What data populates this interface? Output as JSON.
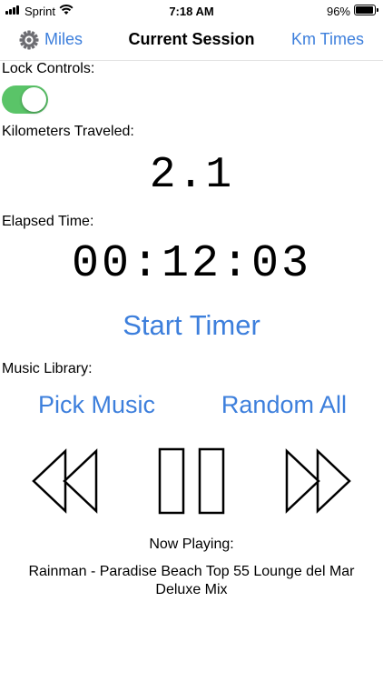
{
  "status_bar": {
    "carrier": "Sprint",
    "time": "7:18 AM",
    "battery_percent": "96%",
    "battery_level": 0.96,
    "icons": [
      "signal-icon",
      "wifi-icon",
      "battery-icon"
    ]
  },
  "nav": {
    "left_label": "Miles",
    "title": "Current Session",
    "right_label": "Km Times",
    "left_icon": "gear-icon"
  },
  "lock": {
    "label": "Lock Controls:",
    "on": true
  },
  "distance": {
    "label": "Kilometers Traveled:",
    "value": "2.1"
  },
  "elapsed": {
    "label": "Elapsed Time:",
    "value": "00:12:03"
  },
  "timer": {
    "start_label": "Start Timer"
  },
  "music": {
    "label": "Music Library:",
    "pick_label": "Pick Music",
    "random_label": "Random All",
    "controls": [
      "rewind-icon",
      "pause-icon",
      "fast-forward-icon"
    ],
    "now_playing_label": "Now Playing:",
    "track": "Rainman - Paradise Beach Top 55 Lounge del Mar Deluxe Mix"
  },
  "colors": {
    "accent": "#3d7fdc",
    "toggle_on": "#5ac468"
  }
}
